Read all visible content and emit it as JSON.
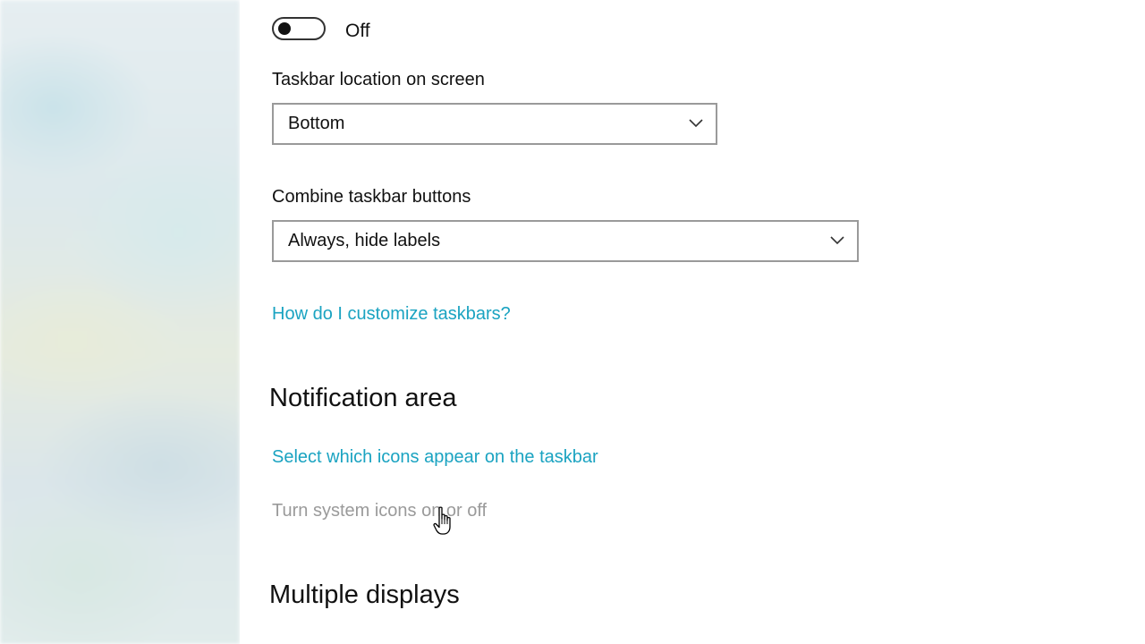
{
  "taskbar_settings": {
    "toggle": {
      "state_label": "Off",
      "checked": false
    },
    "location": {
      "label": "Taskbar location on screen",
      "selected": "Bottom"
    },
    "combine": {
      "label": "Combine taskbar buttons",
      "selected": "Always, hide labels"
    },
    "help_link": "How do I customize taskbars?"
  },
  "notification_area": {
    "heading": "Notification area",
    "select_icons_link": "Select which icons appear on the taskbar",
    "system_icons_link": "Turn system icons on or off"
  },
  "multiple_displays": {
    "heading": "Multiple displays"
  },
  "colors": {
    "link": "#1aa3c1",
    "disabled_link": "#9a9a9a",
    "text": "#111111"
  },
  "icons": {
    "dropdown": "chevron-down-icon",
    "cursor": "hand-pointer-icon"
  }
}
